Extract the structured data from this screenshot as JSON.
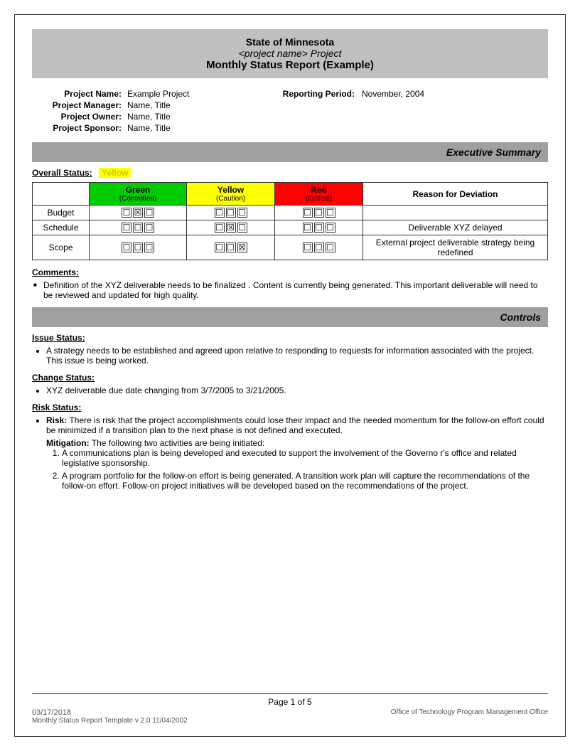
{
  "header": {
    "line1": "State of Minnesota",
    "line2": "<project name> Project",
    "line3": "Monthly Status Report (Example)"
  },
  "projectInfo": {
    "projectNameLabel": "Project Name:",
    "projectNameValue": "Example Project",
    "reportingPeriodLabel": "Reporting Period:",
    "reportingPeriodValue": "November, 2004",
    "projectManagerLabel": "Project Manager:",
    "projectManagerValue": "Name, Title",
    "projectOwnerLabel": "Project Owner:",
    "projectOwnerValue": "Name, Title",
    "projectSponsorLabel": "Project Sponsor:",
    "projectSponsorValue": "Name, Title"
  },
  "executiveSummary": {
    "title": "Executive Summary",
    "overallStatusLabel": "Overall Status:",
    "overallStatusValue": "Yellow",
    "table": {
      "colHeaders": [
        {
          "label": "Green",
          "sub": "(Controlled)"
        },
        {
          "label": "Yellow",
          "sub": "(Caution)"
        },
        {
          "label": "Red",
          "sub": "(Critical)"
        },
        {
          "label": "Reason for Deviation"
        }
      ],
      "rows": [
        {
          "label": "Budget",
          "green": [
            false,
            true,
            false
          ],
          "yellow": [
            false,
            false,
            false
          ],
          "red": [
            false,
            false,
            false
          ],
          "reason": ""
        },
        {
          "label": "Schedule",
          "green": [
            false,
            false,
            false
          ],
          "yellow": [
            false,
            true,
            false
          ],
          "red": [
            false,
            false,
            false
          ],
          "reason": "Deliverable XYZ delayed"
        },
        {
          "label": "Scope",
          "green": [
            false,
            false,
            false
          ],
          "yellow": [
            false,
            false,
            true
          ],
          "red": [
            false,
            false,
            false
          ],
          "reason": "External project deliverable strategy being redefined"
        }
      ]
    },
    "commentsLabel": "Comments:",
    "comments": [
      "Definition of the XYZ deliverable  needs to be finalized .  Content is currently being generated.  This important deliverable will need to be reviewed and updated for high quality."
    ]
  },
  "controls": {
    "title": "Controls",
    "issueStatusLabel": "Issue Status:",
    "issueItems": [
      "A strategy needs to be established and agreed upon relative to  responding to  requests for information associated with the project.  This issue is being worked."
    ],
    "changeStatusLabel": "Change Status:",
    "changeItems": [
      "XYZ  deliverable due date changing from   3/7/2005 to 3/21/2005."
    ],
    "riskStatusLabel": "Risk Status:",
    "riskBold": "Risk:",
    "riskText": " There is risk that the project accomplishments could lose their impact and the needed momentum for the follow-on effort could be   minimized if a transition plan to the next phase is not defined and executed.",
    "mitigationBold": "Mitigation:",
    "mitigationIntro": "  The following two activities are being initiated:",
    "mitigationItems": [
      "A communications plan is being developed and executed to support the involvement of the Governo r's office and related legislative sponsorship.",
      "A program portfolio for the follow-on effort is being generated.  A transition work plan will capture the recommendations of the follow-on effort. Follow-on project initiatives will be developed based on the recommendations of the project."
    ]
  },
  "footer": {
    "pageInfo": "Page 1 of 5",
    "date": "03/17/2018",
    "templateInfo": "Monthly Status Report Template  v 2.0  11/04/2002",
    "office": "Office of Technology Program Management Office"
  }
}
